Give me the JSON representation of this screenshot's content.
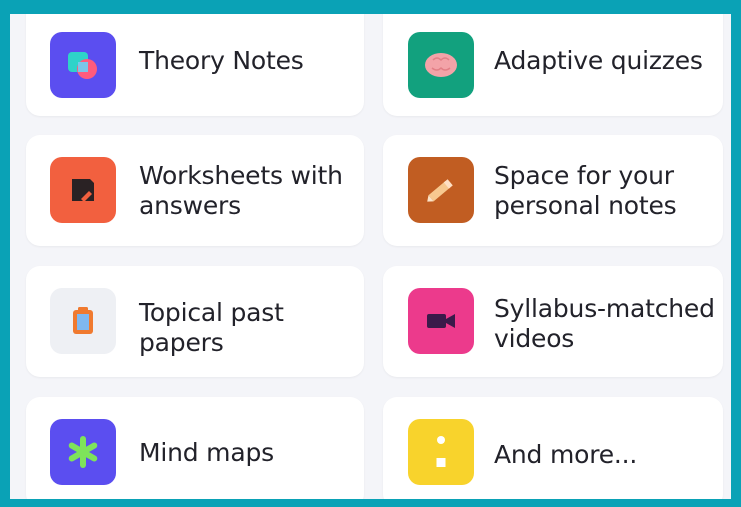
{
  "features": [
    {
      "label_line1": "Theory Notes",
      "label_line2": "",
      "icon": "notes-shapes-icon",
      "icon_bg": "#5b4ef0"
    },
    {
      "label_line1": "Adaptive quizzes",
      "label_line2": "",
      "icon": "brain-icon",
      "icon_bg": "#12a17e"
    },
    {
      "label_line1": "Worksheets with",
      "label_line2": "answers",
      "icon": "worksheet-icon",
      "icon_bg": "#f2603f"
    },
    {
      "label_line1": "Space for your",
      "label_line2": "personal notes",
      "icon": "pencil-icon",
      "icon_bg": "#c15d22"
    },
    {
      "label_line1": "Topical past",
      "label_line2": "papers",
      "icon": "clipboard-icon",
      "icon_bg": "#eef0f4"
    },
    {
      "label_line1": "Syllabus-matched",
      "label_line2": "videos",
      "icon": "video-camera-icon",
      "icon_bg": "#ec3a8c"
    },
    {
      "label_line1": "Mind maps",
      "label_line2": "",
      "icon": "asterisk-icon",
      "icon_bg": "#5b4ef0"
    },
    {
      "label_line1": "And more...",
      "label_line2": "",
      "icon": "exclamation-icon",
      "icon_bg": "#f8d32c"
    }
  ],
  "colors": {
    "frame_border": "#0aa2b6",
    "background": "#f4f5f9",
    "card": "#ffffff",
    "text": "#22222a"
  }
}
